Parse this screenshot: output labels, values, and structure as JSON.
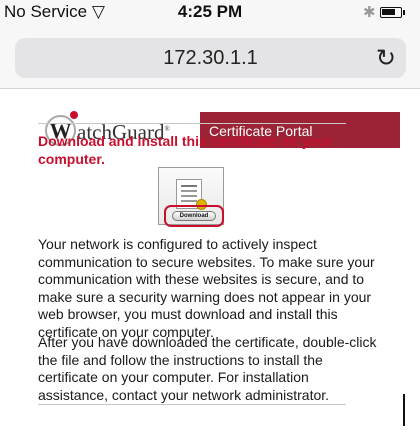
{
  "status_bar": {
    "carrier": "No Service",
    "wifi_icon": "wifi-icon",
    "time": "4:25 PM",
    "bluetooth_icon": "bluetooth-icon",
    "battery_icon": "battery-icon"
  },
  "browser": {
    "url": "172.30.1.1",
    "reload_icon": "reload-icon"
  },
  "portal": {
    "logo_text": "WatchGuard",
    "banner_title": "Certificate Portal",
    "headline": "Download and install this certificate on your computer.",
    "certificate_icon": "certificate-icon",
    "download_label": "Download",
    "paragraph_1": "Your network is configured to actively inspect communication to secure websites. To make sure your communication with these websites is secure, and to make sure a security warning does not appear in your web browser, you must download and install this certificate on your computer.",
    "paragraph_2": "After you have downloaded the certificate, double-click the file and follow the instructions to install the certificate on your computer. For installation assistance, contact your network administrator."
  },
  "colors": {
    "brand_red": "#c8102e",
    "banner": "#9b2335"
  }
}
